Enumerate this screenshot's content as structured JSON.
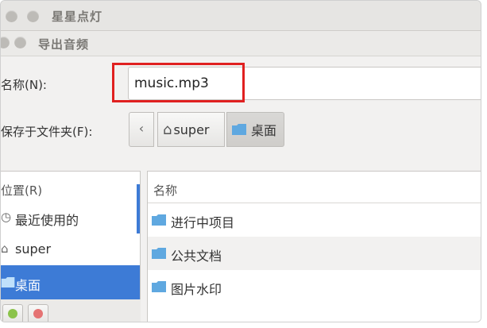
{
  "back_window": {
    "title": "星星点灯"
  },
  "dialog": {
    "title": "导出音频"
  },
  "name_field": {
    "label": "名称(N):",
    "value": "music.mp3"
  },
  "save_folder": {
    "label": "保存于文件夹(F):",
    "back_glyph": "‹",
    "path": [
      {
        "label": "super",
        "icon": "home-icon"
      },
      {
        "label": "桌面",
        "icon": "folder-icon",
        "active": true
      }
    ]
  },
  "places": {
    "header": "位置(R)",
    "items": [
      {
        "label": "最近使用的",
        "icon": "clock-icon"
      },
      {
        "label": "super",
        "icon": "home-icon"
      },
      {
        "label": "桌面",
        "icon": "folder-icon",
        "selected": true
      }
    ]
  },
  "files": {
    "column_name": "名称",
    "rows": [
      {
        "name": "进行中项目",
        "icon": "folder-icon"
      },
      {
        "name": "公共文档",
        "icon": "folder-icon"
      },
      {
        "name": "图片水印",
        "icon": "folder-icon"
      }
    ]
  },
  "colors": {
    "selection": "#3d7bd6",
    "highlight_box": "#e02020",
    "folder": "#5fa8e0"
  }
}
